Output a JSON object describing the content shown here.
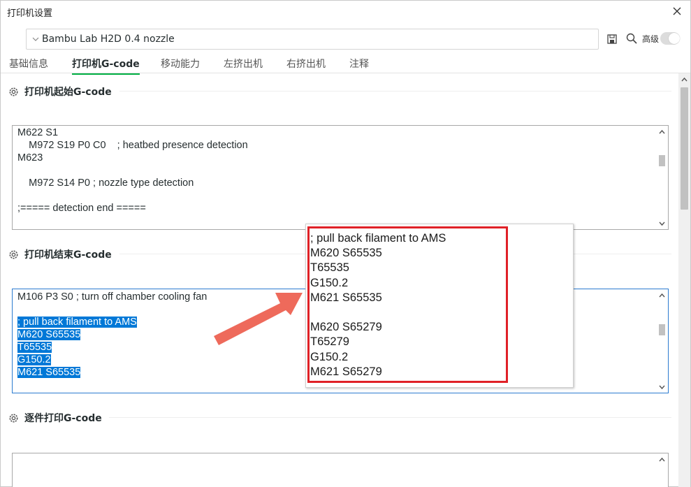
{
  "window": {
    "title": "打印机设置"
  },
  "preset": {
    "name": "Bambu Lab H2D 0.4 nozzle",
    "advanced_label": "高级"
  },
  "tabs": [
    {
      "label": "基础信息"
    },
    {
      "label": "打印机G-code"
    },
    {
      "label": "移动能力"
    },
    {
      "label": "左挤出机"
    },
    {
      "label": "右挤出机"
    },
    {
      "label": "注释"
    }
  ],
  "sections": {
    "start": {
      "title": "打印机起始G-code",
      "lines": [
        "M622 S1",
        "    M972 S19 P0 C0    ; heatbed presence detection",
        "M623",
        "",
        "    M972 S14 P0 ; nozzle type detection",
        "",
        ";===== detection end ====="
      ]
    },
    "end": {
      "title": "打印机结束G-code",
      "lines": [
        "M106 P3 S0 ; turn off chamber cooling fan",
        "",
        "; pull back filament to AMS",
        "M620 S65535",
        "T65535",
        "G150.2",
        "M621 S65535"
      ]
    },
    "change": {
      "title": "逐件打印G-code"
    }
  },
  "popup": {
    "lines": [
      "; pull back filament to AMS",
      "M620 S65535",
      "T65535",
      "G150.2",
      "M621 S65535",
      "",
      "M620 S65279",
      "T65279",
      "G150.2",
      "M621 S65279"
    ]
  },
  "colors": {
    "accent": "#00ae42",
    "selection": "#0078d7",
    "annotation": "#e02127",
    "arrow": "#ee6a5b"
  }
}
